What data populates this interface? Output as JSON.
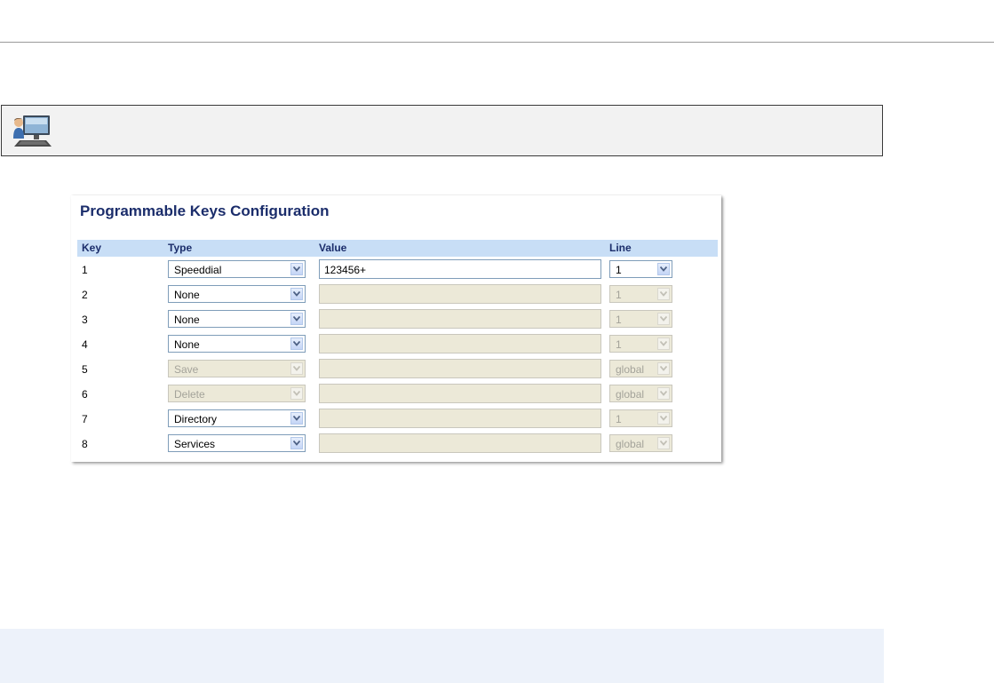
{
  "config": {
    "title": "Programmable Keys Configuration",
    "columns": {
      "key": "Key",
      "type": "Type",
      "value": "Value",
      "line": "Line"
    },
    "rows": [
      {
        "key": "1",
        "type": "Speeddial",
        "type_enabled": true,
        "value": "123456+",
        "value_enabled": true,
        "line": "1",
        "line_enabled": true
      },
      {
        "key": "2",
        "type": "None",
        "type_enabled": true,
        "value": "",
        "value_enabled": false,
        "line": "1",
        "line_enabled": false
      },
      {
        "key": "3",
        "type": "None",
        "type_enabled": true,
        "value": "",
        "value_enabled": false,
        "line": "1",
        "line_enabled": false
      },
      {
        "key": "4",
        "type": "None",
        "type_enabled": true,
        "value": "",
        "value_enabled": false,
        "line": "1",
        "line_enabled": false
      },
      {
        "key": "5",
        "type": "Save",
        "type_enabled": false,
        "value": "",
        "value_enabled": false,
        "line": "global",
        "line_enabled": false
      },
      {
        "key": "6",
        "type": "Delete",
        "type_enabled": false,
        "value": "",
        "value_enabled": false,
        "line": "global",
        "line_enabled": false
      },
      {
        "key": "7",
        "type": "Directory",
        "type_enabled": true,
        "value": "",
        "value_enabled": false,
        "line": "1",
        "line_enabled": false
      },
      {
        "key": "8",
        "type": "Services",
        "type_enabled": true,
        "value": "",
        "value_enabled": false,
        "line": "global",
        "line_enabled": false
      }
    ]
  },
  "icons": {
    "note": "computer-user-icon",
    "dropdown": "chevron-down-icon"
  },
  "colors": {
    "title": "#1b2d6b",
    "header_band": "#c8def6",
    "disabled_field": "#ece9d8",
    "bottom_band": "#edf2fa"
  }
}
